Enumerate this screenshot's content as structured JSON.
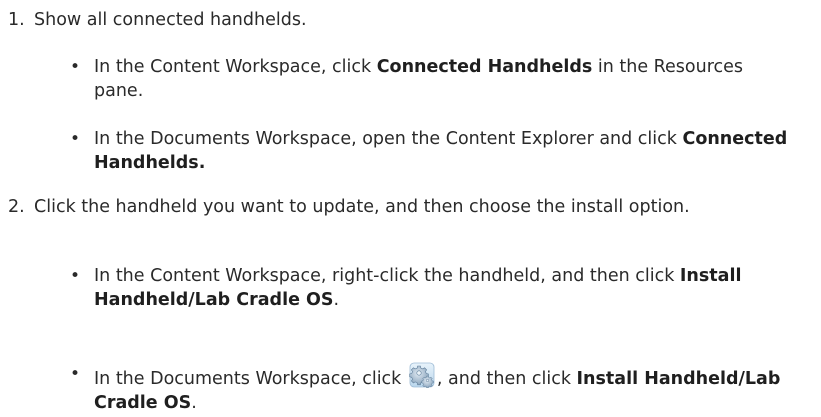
{
  "steps": [
    {
      "number": "1.",
      "text": "Show all connected handhelds.",
      "bullets": [
        {
          "dot": "•",
          "pre": "In the Content Workspace, click ",
          "bold": "Connected Handhelds",
          "post": " in the Resources pane."
        },
        {
          "dot": "•",
          "pre": "In the Documents Workspace, open the Content Explorer and click ",
          "bold": "Connected Handhelds.",
          "post": ""
        }
      ]
    },
    {
      "number": "2.",
      "text": "Click the handheld you want to update, and then choose the install option.",
      "bullets": [
        {
          "dot": "•",
          "pre": "In the Content Workspace, right-click the handheld, and then click ",
          "bold": "Install Handheld/Lab Cradle OS",
          "post": "."
        },
        {
          "dot": "•",
          "pre": "In the Documents Workspace, click ",
          "icon": "gear-settings-icon",
          "mid": ", and then click ",
          "bold": "Install Handheld/Lab Cradle OS",
          "post": "."
        }
      ]
    }
  ]
}
